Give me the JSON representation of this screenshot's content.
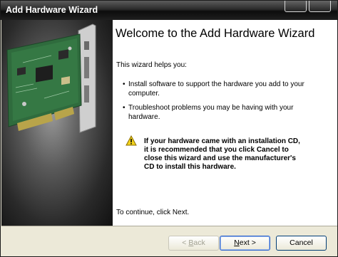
{
  "window": {
    "title": "Add Hardware Wizard"
  },
  "wizard": {
    "heading": "Welcome to the Add Hardware Wizard",
    "intro": "This wizard helps you:",
    "bullets": [
      [
        "Install software to support the hardware you add to your",
        "computer."
      ],
      [
        "Troubleshoot problems you may be having with your",
        "hardware."
      ]
    ],
    "warning_lines": [
      "If your hardware came with an installation CD,",
      "it is recommended that you click Cancel to",
      "close this wizard and use the manufacturer's",
      "CD to install this hardware."
    ],
    "continue_text": "To continue, click Next."
  },
  "buttons": {
    "back": {
      "prefix": "< ",
      "mnemonic": "B",
      "rest": "ack"
    },
    "next": {
      "mnemonic": "N",
      "rest": "ext >"
    },
    "cancel": "Cancel"
  },
  "colors": {
    "titlebar": "#1a1a1a",
    "dialog_bg": "#ece9d8",
    "warning_icon": "#f2d21b"
  }
}
